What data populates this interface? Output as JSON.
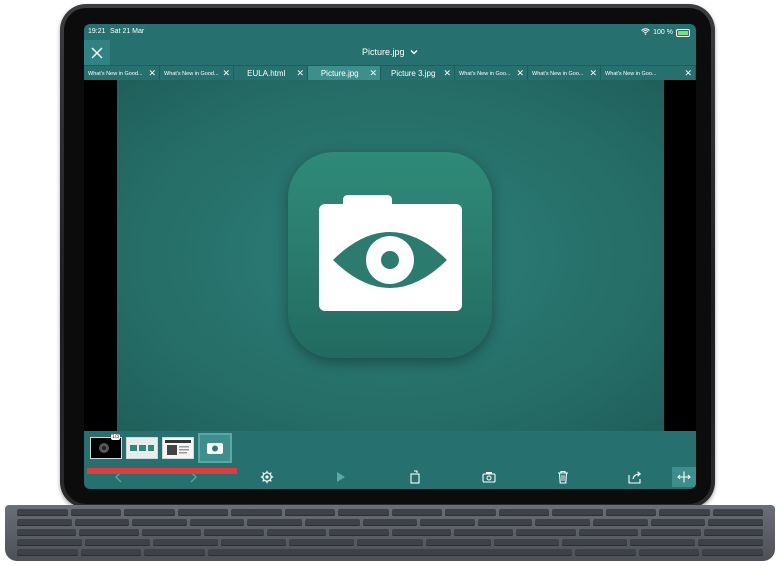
{
  "status": {
    "time": "19:21",
    "date": "Sat 21 Mar",
    "battery": "100 %",
    "battery_level": 1.0
  },
  "header": {
    "title": "Picture.jpg"
  },
  "tabs": [
    {
      "label": "What's New in Good...",
      "size": "small"
    },
    {
      "label": "What's New in Good...",
      "size": "small"
    },
    {
      "label": "EULA.html",
      "size": "big"
    },
    {
      "label": "Picture.jpg",
      "size": "big",
      "active": true
    },
    {
      "label": "Picture 3.jpg",
      "size": "big"
    },
    {
      "label": "What's New in Goo...",
      "size": "small"
    },
    {
      "label": "What's New in Goo...",
      "size": "small"
    },
    {
      "label": "What's New in Goo...",
      "size": "small"
    }
  ],
  "thumbnails": {
    "badge": "1/3"
  },
  "colors": {
    "accent": "#26706f",
    "active_tab": "#3d8f8d",
    "highlight_red": "#e23a3f"
  },
  "toolbar": {
    "icons": [
      "back-icon",
      "forward-icon",
      "settings-icon",
      "play-icon",
      "rotate-icon",
      "camera-icon",
      "trash-icon",
      "share-icon",
      "expand-icon"
    ]
  }
}
